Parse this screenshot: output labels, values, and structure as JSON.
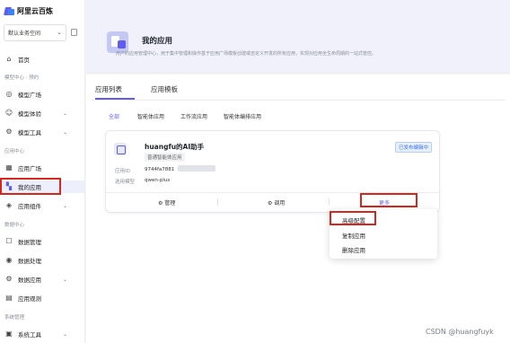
{
  "sidebar": {
    "logo_text": "阿里云百炼",
    "workspace": "默认业务空间",
    "items": [
      {
        "label": "首页",
        "icon": "home-icon",
        "glyph": "⌂"
      },
      {
        "label": "模型广场",
        "icon": "model-square-icon",
        "glyph": "◎"
      },
      {
        "label": "模型体验",
        "icon": "model-experience-icon",
        "glyph": "☺"
      },
      {
        "label": "模型工具",
        "icon": "model-tools-icon",
        "glyph": "⚙"
      },
      {
        "label": "应用广场",
        "icon": "app-square-icon",
        "glyph": "▦"
      },
      {
        "label": "我的应用",
        "icon": "my-apps-icon",
        "glyph": "▚"
      },
      {
        "label": "应用组件",
        "icon": "app-components-icon",
        "glyph": "◈"
      },
      {
        "label": "数据管理",
        "icon": "data-management-icon",
        "glyph": "☐"
      },
      {
        "label": "数据处理",
        "icon": "data-processing-icon",
        "glyph": "◉"
      },
      {
        "label": "数据应用",
        "icon": "data-apps-icon",
        "glyph": "⚙"
      },
      {
        "label": "应用观测",
        "icon": "app-monitor-icon",
        "glyph": "▤"
      },
      {
        "label": "系统工具",
        "icon": "system-tools-icon",
        "glyph": "▣"
      }
    ],
    "groups": {
      "model_center": "模型中心 · 预约",
      "app_center": "应用中心",
      "data_center": "数据中心",
      "system_mgmt": "系统管理"
    }
  },
  "header": {
    "title": "我的应用",
    "description": "用户的应用管理中心，用于集中管理和操作基于应用广场模板创建或自定义开发的所有应用，实现对应用全生命周期的一站式管控。"
  },
  "tabs": [
    "应用列表",
    "应用模板"
  ],
  "filters": [
    "全部",
    "智能体应用",
    "工作流应用",
    "智能体编排应用"
  ],
  "app_card": {
    "name": "huangfu的AI助手",
    "tag": "普通智能体应用",
    "status": "已发布编辑中",
    "id_label": "应用ID",
    "id_value": "9744fa7881",
    "model_label": "选用模型",
    "model_value": "qwen-plus",
    "actions": {
      "manage": "⚙ 管理",
      "invoke": "⚙ 调用",
      "more": "更多"
    }
  },
  "dropdown": [
    "高级配置",
    "复制应用",
    "删除应用"
  ],
  "watermark": "CSDN @huangfuyk",
  "colors": {
    "accent": "#615ced",
    "highlight": "#d9261c",
    "status": "#3b6ff5"
  }
}
